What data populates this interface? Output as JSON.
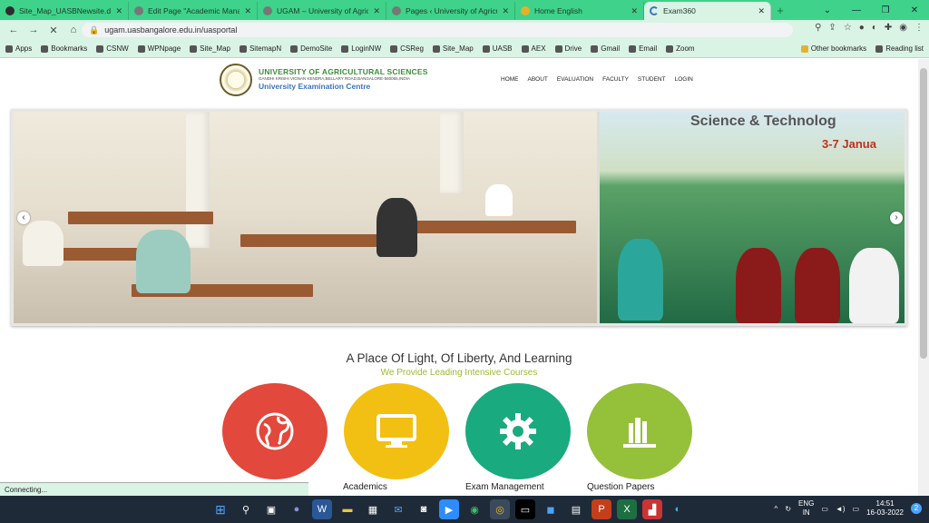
{
  "browser": {
    "tabs": [
      {
        "title": "Site_Map_UASBNewsite.docx",
        "fav": "globe-icon",
        "active": false
      },
      {
        "title": "Edit Page \"Academic Manage",
        "fav": "page-icon",
        "active": false
      },
      {
        "title": "UGAM – University of Agricu",
        "fav": "page-icon",
        "active": false
      },
      {
        "title": "Pages ‹ University of Agricult",
        "fav": "page-icon",
        "active": false
      },
      {
        "title": "Home English",
        "fav": "home-icon",
        "active": false
      },
      {
        "title": "Exam360",
        "fav": "loading-icon",
        "active": true
      }
    ],
    "url": "ugam.uasbangalore.edu.in/uasportal",
    "bookmarks": [
      "Apps",
      "Bookmarks",
      "CSNW",
      "WPNpage",
      "Site_Map",
      "SitemapN",
      "DemoSite",
      "LoginNW",
      "CSReg",
      "Site_Map",
      "UASB",
      "AEX",
      "Drive",
      "Gmail",
      "Email",
      "Zoom"
    ],
    "other_bookmarks": "Other bookmarks",
    "reading_list": "Reading list",
    "status": "Connecting..."
  },
  "site": {
    "university": "UNIVERSITY OF AGRICULTURAL SCIENCES",
    "address": "GANDHI KRISHI VIGNAN KENDRA,BELLARY ROAD,BANGALORE-560065,INDIA",
    "centre": "University Examination Centre",
    "nav": [
      "HOME",
      "ABOUT",
      "EVALUATION",
      "FACULTY",
      "STUDENT",
      "LOGIN"
    ],
    "banner_text_1": "Science & Technolog",
    "banner_text_2": "3-7 Janua",
    "tagline": "A Place Of Light, Of Liberty, And Learning",
    "subtag": "We Provide Leading Intensive Courses",
    "features": [
      {
        "label": "",
        "color": "#e2483b",
        "icon": "globe-icon"
      },
      {
        "label": "Academics",
        "color": "#f2c012",
        "icon": "monitor-icon"
      },
      {
        "label": "Exam Management",
        "color": "#1aaa7f",
        "icon": "gear-icon"
      },
      {
        "label": "Question Papers",
        "color": "#95c03a",
        "icon": "books-icon"
      }
    ]
  },
  "taskbar": {
    "lang": "ENG",
    "region": "IN",
    "time": "14:51",
    "date": "16-03-2022",
    "badge": "2"
  }
}
